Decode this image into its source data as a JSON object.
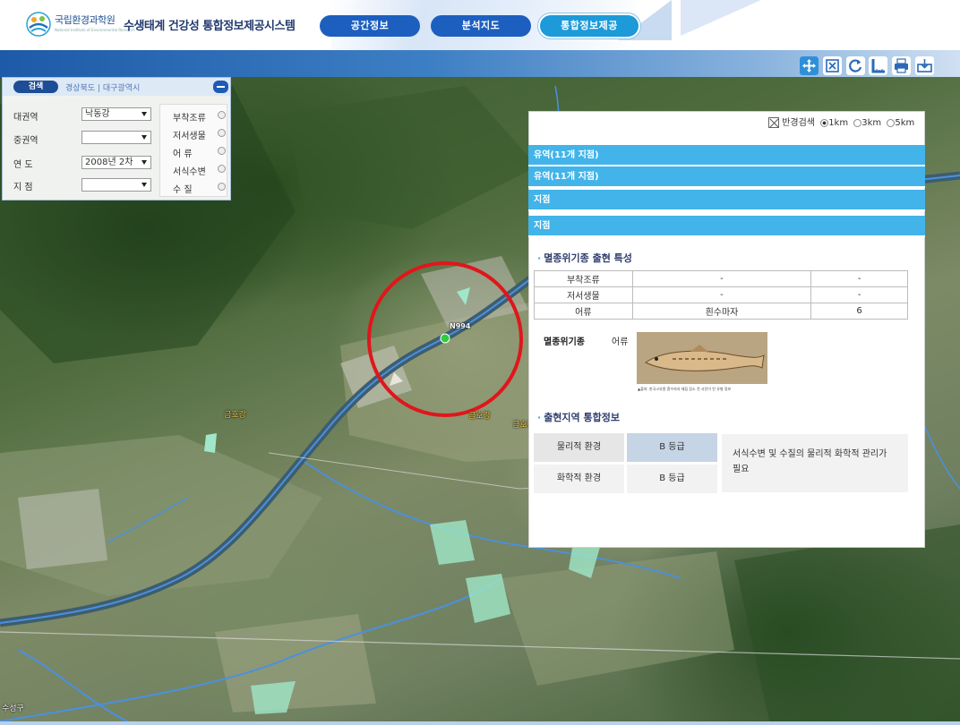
{
  "header": {
    "org_name": "국립환경과학원",
    "org_sub": "National Institute of Environmental Research",
    "system_title": "수생태계 건강성 통합정보제공시스템",
    "nav": [
      {
        "label": "공간정보"
      },
      {
        "label": "분석지도"
      },
      {
        "label": "통합정보제공"
      }
    ],
    "active_nav": "통합정보제공"
  },
  "toolbar": {
    "tools": [
      {
        "icon": "pan-move-icon",
        "color": "#2f8fd8"
      },
      {
        "icon": "zoom-extent-icon",
        "color": "#2a6bb8"
      },
      {
        "icon": "refresh-icon",
        "color": "#2a6bb8"
      },
      {
        "icon": "measure-ruler-icon",
        "color": "#2a6bb8"
      },
      {
        "icon": "print-icon",
        "color": "#2a6bb8"
      },
      {
        "icon": "save-image-icon",
        "color": "#2a6bb8"
      }
    ]
  },
  "search_panel": {
    "button": "검색",
    "path": "경상북도 | 대구광역시",
    "fields": [
      {
        "label": "대권역",
        "value": "낙동강"
      },
      {
        "label": "중권역",
        "value": ""
      },
      {
        "label": "연  도",
        "value": "2008년 2차"
      },
      {
        "label": "지  점",
        "value": ""
      }
    ],
    "categories": [
      "부착조류",
      "저서생물",
      "어    류",
      "서식수변",
      "수    질"
    ]
  },
  "map": {
    "labels": [
      "금호강",
      "금호강",
      "금호강",
      "수성구"
    ],
    "marker_label": "N994",
    "marker_color": "#2ecc40",
    "highlight_color": "#e0161b"
  },
  "info_panel": {
    "radius_label": "반경검색",
    "radius_options": [
      "1km",
      "3km",
      "5km"
    ],
    "radius_selected": "1km",
    "sections": [
      "유역(11개 지점)",
      "유역(11개 지점)",
      "지점",
      "지점"
    ],
    "endangered_title": "멸종위기종 출현 특성",
    "endangered_table": [
      [
        "부착조류",
        "-",
        "-"
      ],
      [
        "저서생물",
        "-",
        "-"
      ],
      [
        "어류",
        "흰수마자",
        "6"
      ]
    ],
    "species_label": "멸종위기종",
    "species_type": "어류",
    "species_caption": "▲출처: 한국고유종 흰수마자 채집 장소 전 사진이 된 유형 정보",
    "region_title": "출현지역 통합정보",
    "env_rows": [
      {
        "label": "물리적 환경",
        "grade": "B 등급"
      },
      {
        "label": "화학적 환경",
        "grade": "B 등급"
      }
    ],
    "env_note": "서식수변 및 수질의 물리적 화학적 관리가 필요"
  }
}
